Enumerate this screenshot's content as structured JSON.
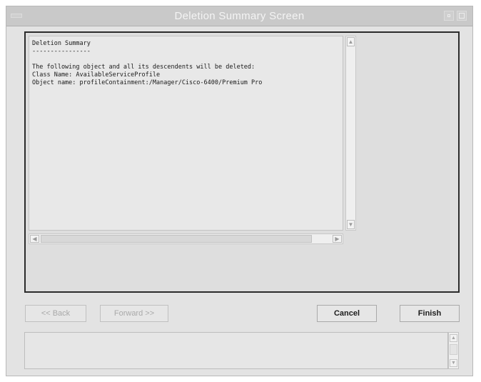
{
  "window": {
    "title": "Deletion Summary Screen"
  },
  "summary": {
    "lines": [
      "Deletion Summary",
      "----------------",
      "",
      "The following object and all its descendents will be deleted:",
      "Class Name: AvailableServiceProfile",
      "Object name: profileContainment:/Manager/Cisco-6400/Premium Pro"
    ]
  },
  "buttons": {
    "back": "<< Back",
    "forward": "Forward >>",
    "cancel": "Cancel",
    "finish": "Finish"
  },
  "icons": {
    "scroll_up": "triangle-up-icon",
    "scroll_down": "triangle-down-icon",
    "scroll_left": "triangle-left-icon",
    "scroll_right": "triangle-right-icon"
  }
}
